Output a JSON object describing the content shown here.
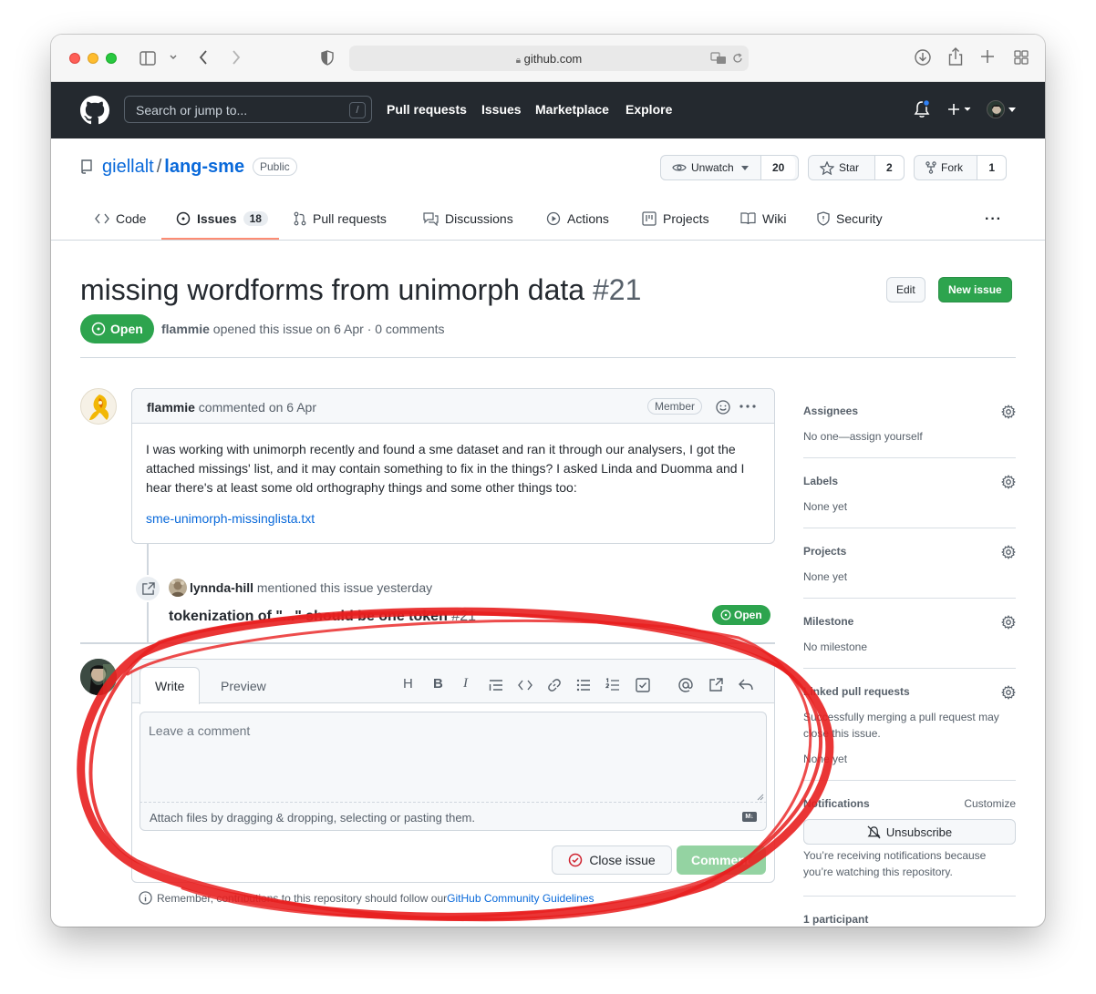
{
  "browser": {
    "url": "github.com"
  },
  "header": {
    "search_placeholder": "Search or jump to...",
    "search_shortcut": "/",
    "nav": [
      "Pull requests",
      "Issues",
      "Marketplace",
      "Explore"
    ]
  },
  "repo": {
    "owner": "giellalt",
    "separator": "/",
    "name": "lang-sme",
    "visibility": "Public",
    "watch_label": "Unwatch",
    "watch_count": "20",
    "star_label": "Star",
    "star_count": "2",
    "fork_label": "Fork",
    "fork_count": "1",
    "tabs": {
      "code": "Code",
      "issues": "Issues",
      "issues_count": "18",
      "pulls": "Pull requests",
      "discussions": "Discussions",
      "actions": "Actions",
      "projects": "Projects",
      "wiki": "Wiki",
      "security": "Security",
      "more": "···"
    }
  },
  "issue": {
    "title": "missing wordforms from unimorph data",
    "number": "#21",
    "edit_label": "Edit",
    "new_issue_label": "New issue",
    "state": "Open",
    "author": "flammie",
    "meta_text": " opened this issue on 6 Apr · 0 comments"
  },
  "comment": {
    "author": "flammie",
    "action": " commented on 6 Apr",
    "role": "Member",
    "body": "I was working with unimorph recently and found a sme dataset and ran it through our analysers, I got the attached missings' list, and it may contain something to fix in the things? I asked Linda and Duomma and I hear there's at least some old orthography things and some other things too:",
    "attachment": "sme-unimorph-missinglista.txt"
  },
  "event": {
    "actor": "lynnda-hill",
    "text": " mentioned this issue yesterday",
    "ref_title": "tokenization of \"...\" should be one token",
    "ref_number": "#21",
    "ref_state": "Open"
  },
  "form": {
    "tab_write": "Write",
    "tab_preview": "Preview",
    "placeholder": "Leave a comment",
    "attach_hint": "Attach files by dragging & dropping, selecting or pasting them.",
    "markdown_badge": "M↓",
    "close_label": "Close issue",
    "comment_label": "Comment",
    "remember_text": "Remember, contributions to this repository should follow our ",
    "guidelines_link": "GitHub Community Guidelines"
  },
  "sidebar": {
    "assignees_title": "Assignees",
    "assignees_value": "No one—assign yourself",
    "labels_title": "Labels",
    "labels_value": "None yet",
    "projects_title": "Projects",
    "projects_value": "None yet",
    "milestone_title": "Milestone",
    "milestone_value": "No milestone",
    "linked_title": "Linked pull requests",
    "linked_desc": "Successfully merging a pull request may close this issue.",
    "linked_value": "None yet",
    "notifications_title": "Notifications",
    "customize_label": "Customize",
    "unsubscribe_label": "Unsubscribe",
    "notifications_desc": "You’re receiving notifications because you’re watching this repository.",
    "participants": "1 participant"
  },
  "colors": {
    "header_bg": "#24292f",
    "link": "#0969da",
    "open_green": "#2da44e",
    "annotation_red": "#e81f1f",
    "tab_underline": "#fd8c73"
  }
}
